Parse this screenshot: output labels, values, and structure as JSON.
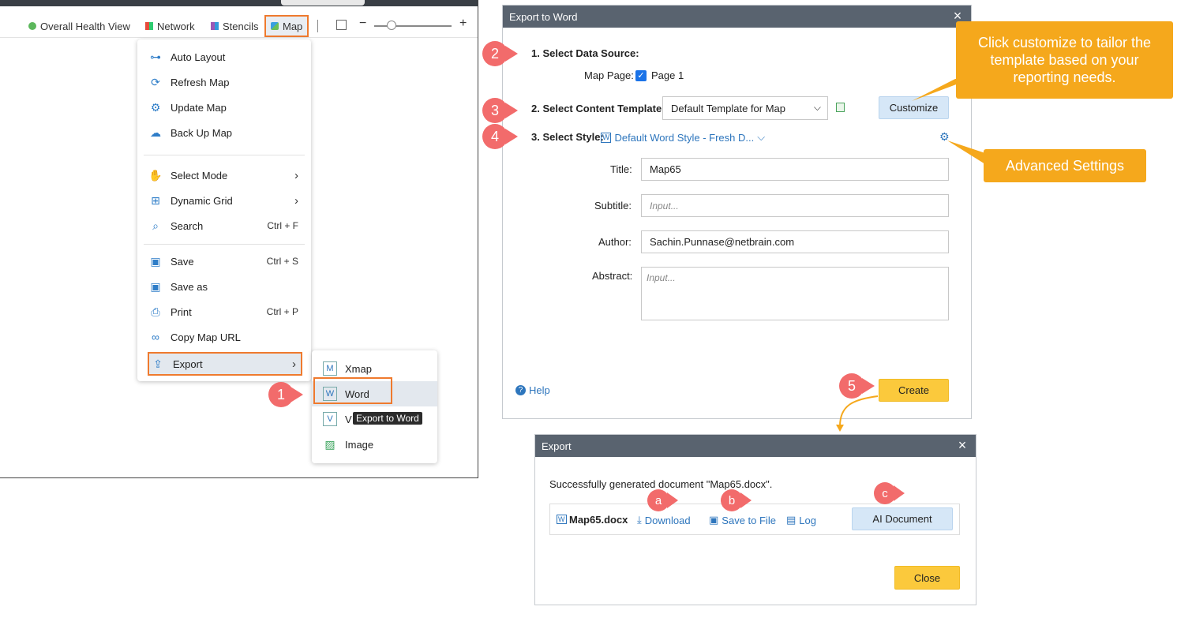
{
  "toolbar": {
    "overall_health": "Overall Health View",
    "network": "Network",
    "stencils": "Stencils",
    "map": "Map"
  },
  "map_menu": {
    "items": [
      {
        "label": "Auto Layout",
        "icon": "auto-layout-icon",
        "shortcut": ""
      },
      {
        "label": "Refresh Map",
        "icon": "refresh-icon",
        "shortcut": ""
      },
      {
        "label": "Update Map",
        "icon": "update-map-icon",
        "shortcut": ""
      },
      {
        "label": "Back Up Map",
        "icon": "cloud-upload-icon",
        "shortcut": ""
      },
      {
        "label": "Select Mode",
        "icon": "hand-icon",
        "shortcut": ""
      },
      {
        "label": "Dynamic Grid",
        "icon": "grid-icon",
        "shortcut": ""
      },
      {
        "label": "Search",
        "icon": "search-icon",
        "shortcut": "Ctrl + F"
      },
      {
        "label": "Save",
        "icon": "save-icon",
        "shortcut": "Ctrl + S"
      },
      {
        "label": "Save as",
        "icon": "save-as-icon",
        "shortcut": ""
      },
      {
        "label": "Print",
        "icon": "print-icon",
        "shortcut": "Ctrl + P"
      },
      {
        "label": "Copy Map URL",
        "icon": "link-icon",
        "shortcut": ""
      },
      {
        "label": "Export",
        "icon": "export-icon",
        "shortcut": ""
      }
    ]
  },
  "export_menu": {
    "items": [
      {
        "label": "Xmap",
        "icon": "xmap-icon"
      },
      {
        "label": "Word",
        "icon": "word-icon"
      },
      {
        "label": "V",
        "icon": "visio-icon"
      },
      {
        "label": "Image",
        "icon": "image-icon"
      }
    ],
    "tooltip": "Export to Word"
  },
  "export_word": {
    "title": "Export to Word",
    "step1_label": "1. Select Data Source:",
    "map_page_label": "Map Page:",
    "page_value": "Page 1",
    "step2_label": "2. Select Content Template:",
    "template_value": "Default Template for Map",
    "customize": "Customize",
    "step3_label": "3. Select Style:",
    "style_value": "Default Word Style - Fresh D...",
    "title_label": "Title:",
    "title_value": "Map65",
    "subtitle_label": "Subtitle:",
    "subtitle_placeholder": "Input...",
    "author_label": "Author:",
    "author_value": "Sachin.Punnase@netbrain.com",
    "abstract_label": "Abstract:",
    "abstract_placeholder": "Input...",
    "help": "Help",
    "create": "Create"
  },
  "export_result": {
    "title": "Export",
    "message": "Successfully generated document \"Map65.docx\".",
    "file_name": "Map65.docx",
    "download": "Download",
    "save_to_file": "Save to File",
    "log": "Log",
    "ai_document": "AI Document",
    "close": "Close"
  },
  "callouts": {
    "customize_tip": "Click customize to tailor the template based on your reporting needs.",
    "advanced": "Advanced Settings",
    "n1": "1",
    "n2": "2",
    "n3": "3",
    "n4": "4",
    "n5": "5",
    "a": "a",
    "b": "b",
    "c": "c"
  },
  "colors": {
    "accent_orange": "#ef7a2e",
    "callout_orange": "#f5a81c",
    "step_red": "#f26b6b",
    "header_gray": "#59636f",
    "button_yellow": "#fbc93c",
    "button_blue": "#d6e7f7"
  }
}
